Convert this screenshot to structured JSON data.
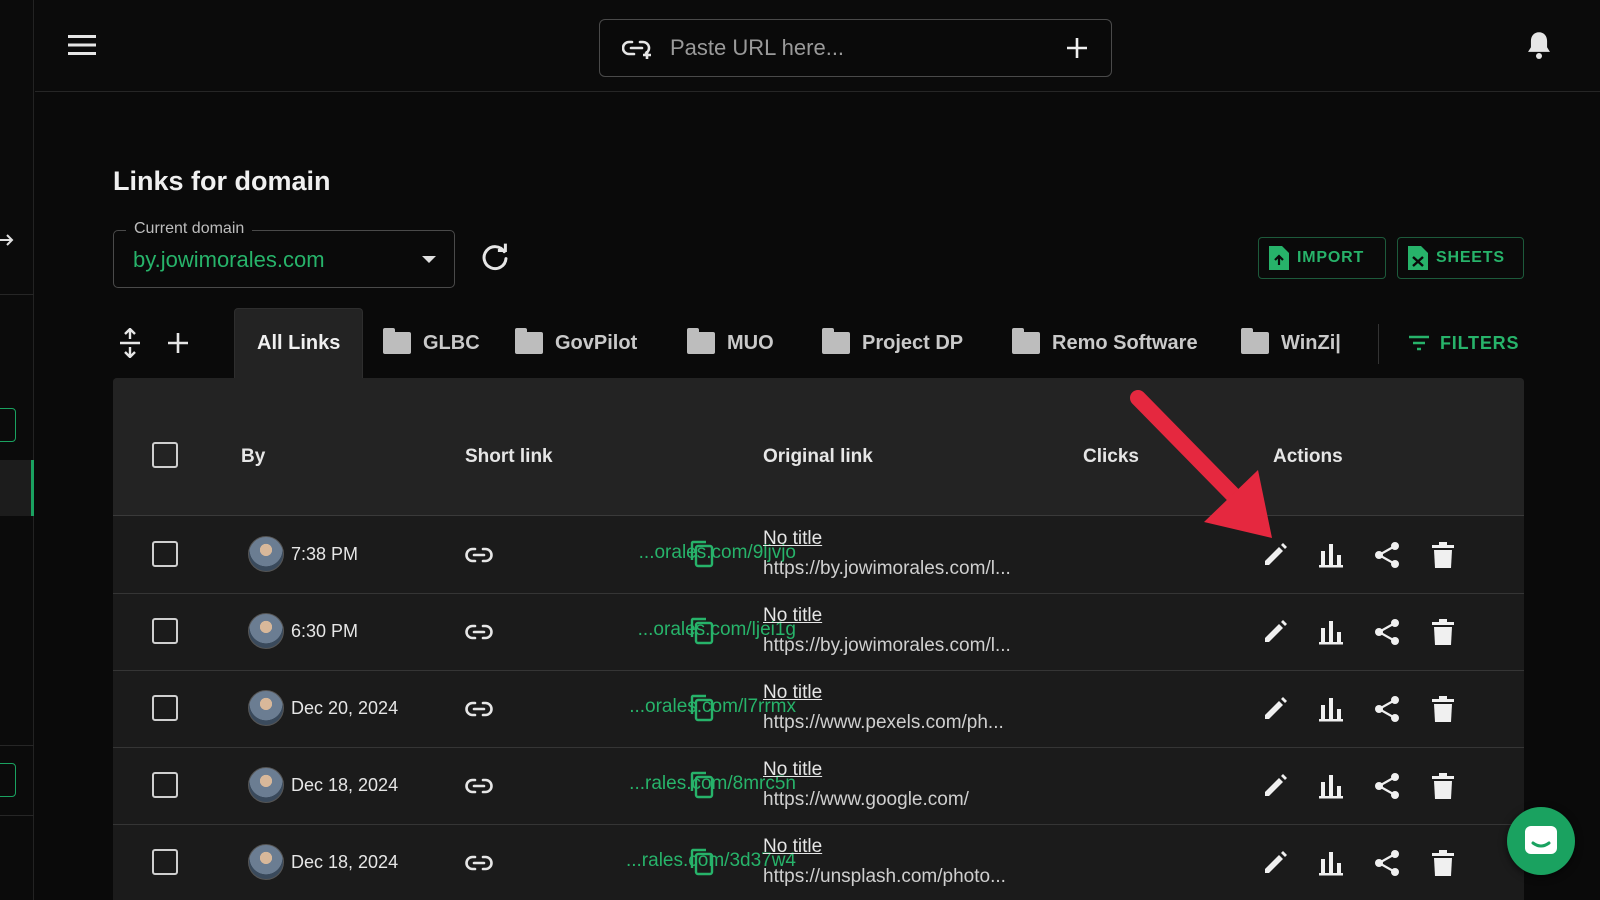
{
  "topbar": {
    "url_placeholder": "Paste URL here..."
  },
  "page": {
    "title": "Links for domain"
  },
  "domain": {
    "label": "Current domain",
    "value": "by.jowimorales.com"
  },
  "toolbar": {
    "import_label": "IMPORT",
    "sheets_label": "SHEETS",
    "filters_label": "FILTERS"
  },
  "tabs": [
    {
      "label": "All Links",
      "folder": false
    },
    {
      "label": "GLBC",
      "folder": true
    },
    {
      "label": "GovPilot",
      "folder": true
    },
    {
      "label": "MUO",
      "folder": true
    },
    {
      "label": "Project DP",
      "folder": true
    },
    {
      "label": "Remo Software",
      "folder": true
    },
    {
      "label": "WinZi|",
      "folder": true
    }
  ],
  "table": {
    "headers": {
      "by": "By",
      "short": "Short link",
      "original": "Original link",
      "clicks": "Clicks",
      "actions": "Actions"
    },
    "rows": [
      {
        "by": "7:38 PM",
        "short": "...orales.com/9ljvjo",
        "title": "No title",
        "url": "https://by.jowimorales.com/l..."
      },
      {
        "by": "6:30 PM",
        "short": "...orales.com/ljei1g",
        "title": "No title",
        "url": "https://by.jowimorales.com/l..."
      },
      {
        "by": "Dec 20, 2024",
        "short": "...orales.com/l7rrmx",
        "title": "No title",
        "url": "https://www.pexels.com/ph..."
      },
      {
        "by": "Dec 18, 2024",
        "short": "...rales.com/8mrc5n",
        "title": "No title",
        "url": "https://www.google.com/"
      },
      {
        "by": "Dec 18, 2024",
        "short": "...rales.com/3d37w4",
        "title": "No title",
        "url": "https://unsplash.com/photo..."
      }
    ]
  },
  "colors": {
    "accent": "#27b36a",
    "annotation": "#e5283f",
    "background": "#0a0a0a"
  }
}
